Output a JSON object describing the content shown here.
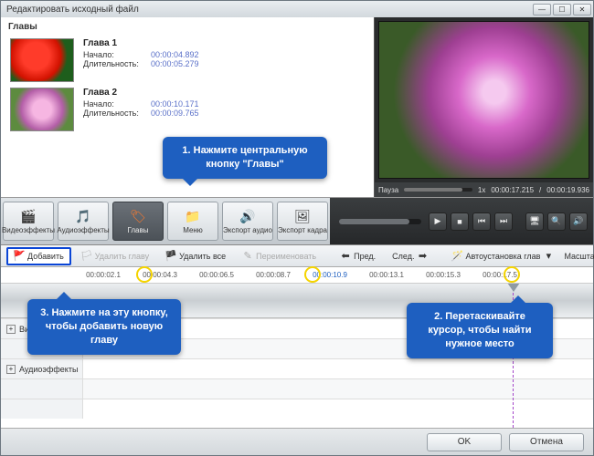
{
  "window": {
    "title": "Редактировать исходный файл"
  },
  "chapters": {
    "heading": "Главы",
    "items": [
      {
        "title": "Глава 1",
        "start_label": "Начало:",
        "start": "00:00:04.892",
        "dur_label": "Длительность:",
        "dur": "00:00:05.279"
      },
      {
        "title": "Глава 2",
        "start_label": "Начало:",
        "start": "00:00:10.171",
        "dur_label": "Длительность:",
        "dur": "00:00:09.765"
      }
    ]
  },
  "preview": {
    "status_label": "Пауза",
    "speed": "1x",
    "time_current": "00:00:17.215",
    "time_total": "00:00:19.936"
  },
  "toolbar": {
    "items": [
      {
        "label": "Видеоэффекты",
        "icon": "🎬"
      },
      {
        "label": "Аудиоэффекты",
        "icon": "🎵"
      },
      {
        "label": "Главы",
        "icon": "🏷",
        "active": true
      },
      {
        "label": "Меню",
        "icon": "📁"
      },
      {
        "label": "Экспорт аудио",
        "icon": "🔊"
      },
      {
        "label": "Экспорт кадра",
        "icon": "🖼"
      }
    ]
  },
  "player": {
    "icons": [
      "▶",
      "■",
      "⏮",
      "⏭",
      "",
      "🖥",
      "🔍",
      "🔊"
    ]
  },
  "secondary": {
    "add": "Добавить",
    "del_chapter": "Удалить главу",
    "del_all": "Удалить все",
    "rename": "Переименовать",
    "prev": "Пред.",
    "next": "След.",
    "auto": "Автоустановка глав",
    "scale": "Масштаб:"
  },
  "ruler": {
    "ticks": [
      "00:00:02.1",
      "00:00:04.3",
      "00:00:06.5",
      "00:00:08.7",
      "00:00:10.9",
      "00:00:13.1",
      "00:00:15.3",
      "00:00:17.5"
    ]
  },
  "tracks": {
    "video_fx": "Видеоэффекты",
    "audio_fx": "Аудиоэффекты"
  },
  "footer": {
    "ok": "OK",
    "cancel": "Отмена"
  },
  "callouts": {
    "c1": "1. Нажмите центральную кнопку \"Главы\"",
    "c2": "2. Перетаскивайте курсор, чтобы найти нужное место",
    "c3": "3. Нажмите на эту кнопку, чтобы добавить новую главу"
  }
}
